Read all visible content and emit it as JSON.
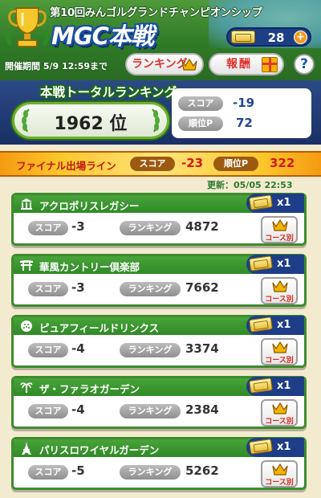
{
  "header": {
    "event_title": "第10回みんゴルグランドチャンピオンシップ",
    "event_logo": "MGC本戦",
    "ticket_count": "28",
    "plus_label": "+",
    "period": "開催期間 5/9 12:59まで",
    "ranking_button": "ランキング",
    "reward_button": "報酬",
    "help_label": "?"
  },
  "total": {
    "title": "本戦トータルランキング",
    "rank": "1962 位",
    "score_label": "スコア",
    "score_value": "-19",
    "points_label": "順位P",
    "points_value": "72"
  },
  "final_line": {
    "label": "ファイナル出場ライン",
    "score_label": "スコア",
    "score_value": "-23",
    "points_label": "順位P",
    "points_value": "322"
  },
  "updated": "更新：05/05 22:53",
  "course_common": {
    "score_label": "スコア",
    "ranking_label": "ランキング",
    "course_button": "コース別"
  },
  "courses": [
    {
      "name": "アクロポリスレガシー",
      "tickets": "x1",
      "score": "-3",
      "ranking": "4872",
      "icon": "temple-icon"
    },
    {
      "name": "華風カントリー倶楽部",
      "tickets": "x1",
      "score": "-3",
      "ranking": "7662",
      "icon": "shrine-gate-icon"
    },
    {
      "name": "ピュアフィールドリンクス",
      "tickets": "x1",
      "score": "-4",
      "ranking": "3374",
      "icon": "golf-ball-icon"
    },
    {
      "name": "ザ・ファラオガーデン",
      "tickets": "x1",
      "score": "-4",
      "ranking": "2384",
      "icon": "palm-icon"
    },
    {
      "name": "パリスロワイヤルガーデン",
      "tickets": "x1",
      "score": "-5",
      "ranking": "5262",
      "icon": "eiffel-tower-icon"
    }
  ],
  "colors": {
    "header_green": "#2f7a27",
    "panel_navy": "#1a2f66",
    "accent_red": "#d3180a",
    "card_green": "#3d8c2f"
  }
}
